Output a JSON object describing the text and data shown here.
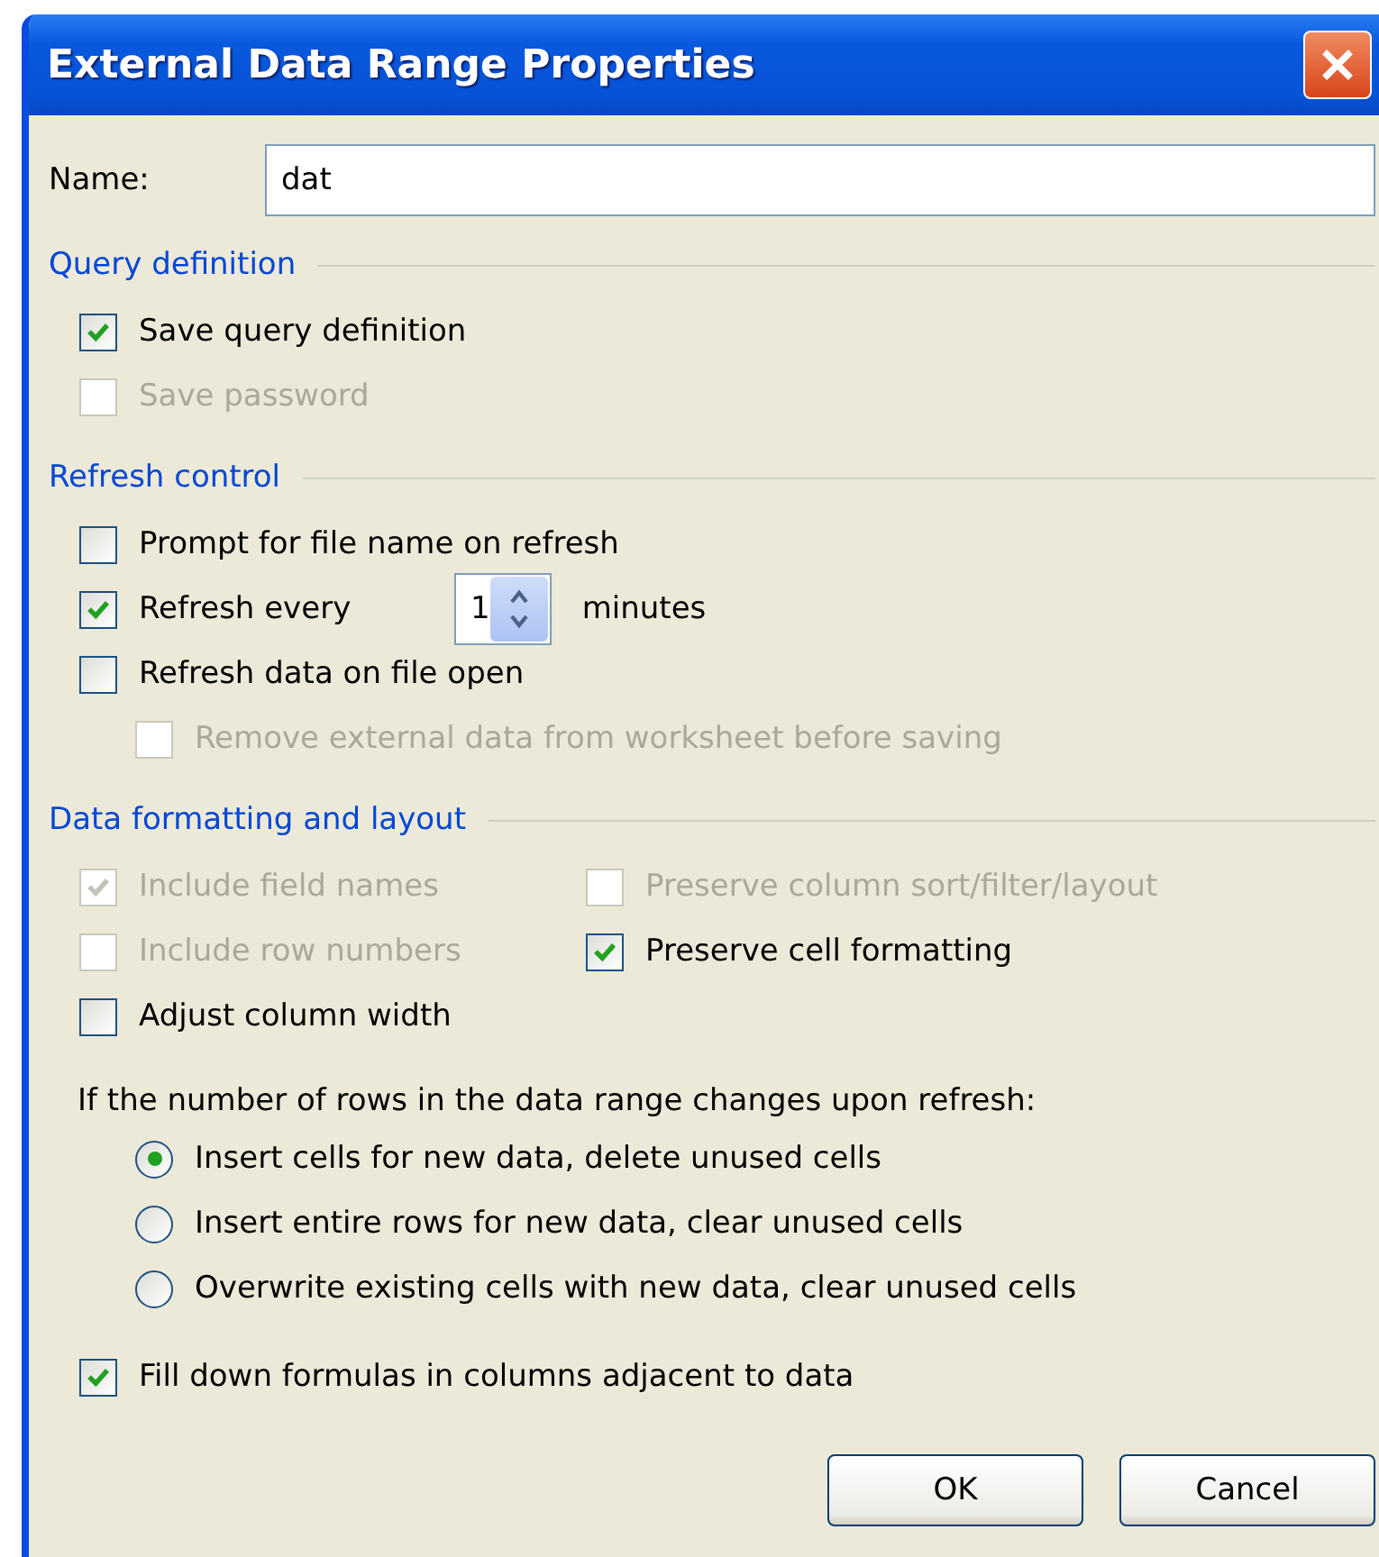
{
  "window": {
    "title": "External Data Range Properties"
  },
  "name_field": {
    "label": "Name:",
    "value": "dat"
  },
  "sections": [
    {
      "title": "Query definition",
      "rows": [
        [
          {
            "kind": "checkbox",
            "label": "Save query definition",
            "checked": true,
            "disabled": false
          }
        ],
        [
          {
            "kind": "checkbox",
            "label": "Save password",
            "checked": false,
            "disabled": true
          }
        ]
      ]
    },
    {
      "title": "Refresh control",
      "rows": [
        [
          {
            "kind": "checkbox",
            "label": "Prompt for file name on refresh",
            "checked": false,
            "disabled": false
          }
        ],
        [
          {
            "kind": "spin",
            "label": "Refresh every",
            "checked": true,
            "disabled": false,
            "value": "1",
            "unit": "minutes"
          }
        ],
        [
          {
            "kind": "checkbox",
            "label": "Refresh data on file open",
            "checked": false,
            "disabled": false,
            "children": [
              {
                "kind": "checkbox",
                "label": "Remove external data from worksheet before saving",
                "checked": false,
                "disabled": true
              }
            ]
          }
        ]
      ]
    },
    {
      "title": "Data formatting and layout",
      "rows": [
        [
          {
            "kind": "checkbox",
            "label": "Include field names",
            "checked": true,
            "disabled": true
          },
          {
            "kind": "checkbox",
            "label": "Preserve column sort/filter/layout",
            "checked": false,
            "disabled": true
          }
        ],
        [
          {
            "kind": "checkbox",
            "label": "Include row numbers",
            "checked": false,
            "disabled": true
          },
          {
            "kind": "checkbox",
            "label": "Preserve cell formatting",
            "checked": true,
            "disabled": false
          }
        ],
        [
          {
            "kind": "checkbox",
            "label": "Adjust column width",
            "checked": false,
            "disabled": false
          }
        ]
      ]
    }
  ],
  "refresh_behavior": {
    "prompt": "If the number of rows in the data range changes upon refresh:",
    "options": [
      {
        "label": "Insert cells for new data, delete unused cells",
        "selected": true
      },
      {
        "label": "Insert entire rows for new data, clear unused cells",
        "selected": false
      },
      {
        "label": "Overwrite existing cells with new data, clear unused cells",
        "selected": false
      }
    ]
  },
  "fill_down": {
    "kind": "checkbox",
    "label": "Fill down formulas in columns adjacent to data",
    "checked": true,
    "disabled": false
  },
  "buttons": [
    {
      "label": "OK"
    },
    {
      "label": "Cancel"
    }
  ]
}
